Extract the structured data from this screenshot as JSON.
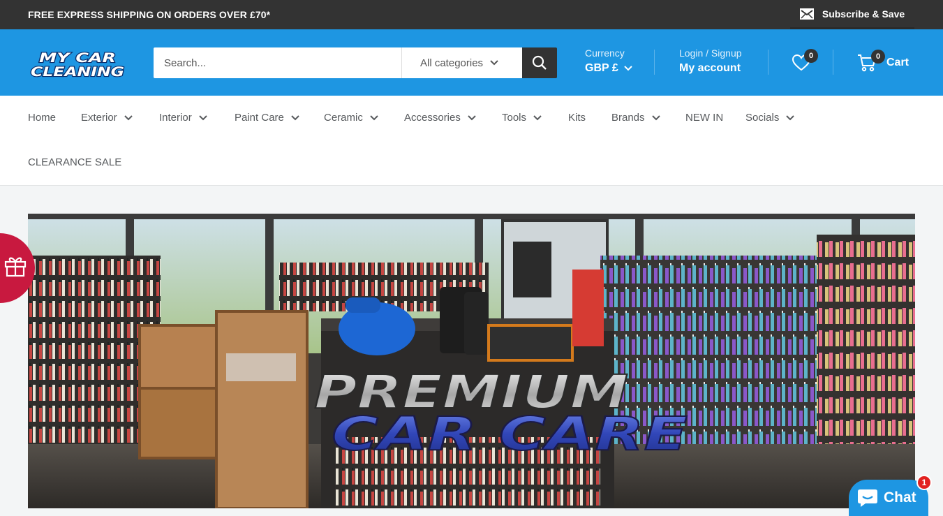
{
  "announcement": {
    "text": "FREE EXPRESS SHIPPING ON ORDERS OVER £70*",
    "subscribe_label": "Subscribe & Save"
  },
  "brand": {
    "logo_line1": "MY CAR",
    "logo_line2": "CLEANING",
    "primary_color": "#1e96e2",
    "dark_color": "#333333"
  },
  "search": {
    "placeholder": "Search...",
    "category_selected": "All categories"
  },
  "currency": {
    "label": "Currency",
    "value": "GBP £"
  },
  "account": {
    "label": "Login / Signup",
    "value": "My account"
  },
  "wishlist": {
    "count": "0"
  },
  "cart": {
    "label": "Cart",
    "count": "0"
  },
  "nav": {
    "items": [
      {
        "label": "Home"
      },
      {
        "label": "Exterior"
      },
      {
        "label": "Interior"
      },
      {
        "label": "Paint Care"
      },
      {
        "label": "Ceramic"
      },
      {
        "label": "Accessories"
      },
      {
        "label": "Tools"
      },
      {
        "label": "Kits"
      },
      {
        "label": "Brands"
      },
      {
        "label": "NEW IN"
      },
      {
        "label": "Socials"
      },
      {
        "label": "CLEARANCE SALE"
      }
    ]
  },
  "hero": {
    "headline_line1": "PREMIUM",
    "headline_line2": "CAR CARE"
  },
  "chat": {
    "label": "Chat",
    "badge": "1"
  },
  "rewards": {
    "icon": "gift-icon",
    "color": "#c8193f"
  }
}
